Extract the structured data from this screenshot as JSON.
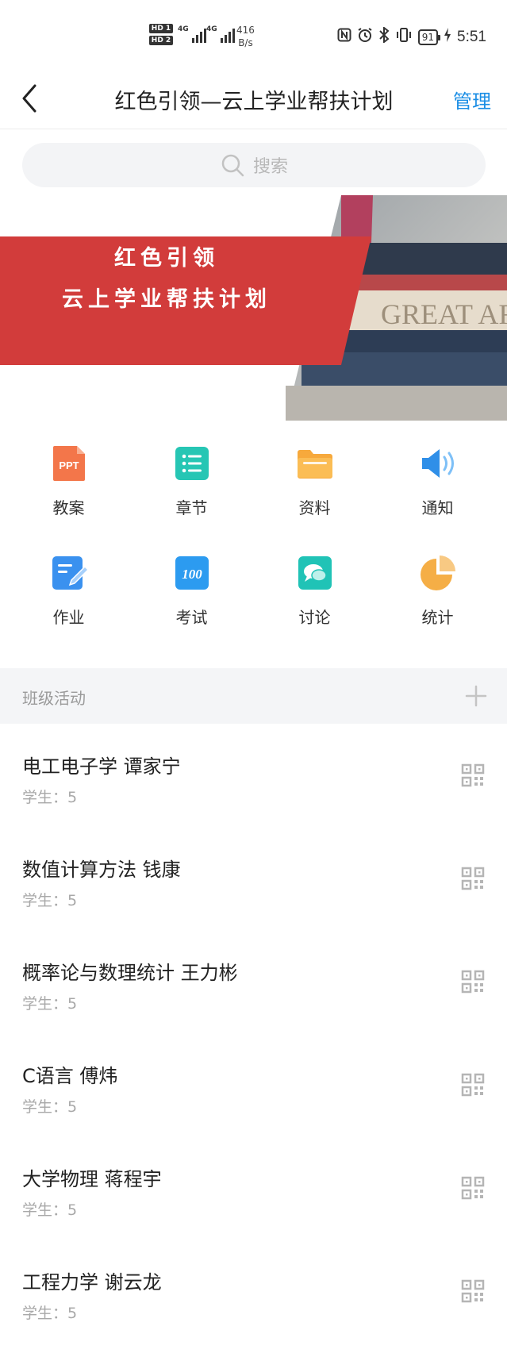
{
  "status_bar": {
    "hd1": "HD 1",
    "hd2": "HD 2",
    "network1": "4G",
    "network2": "4G",
    "speed_value": "416",
    "speed_unit": "B/s",
    "battery": "91",
    "time": "5:51",
    "icons": [
      "nfc-icon",
      "alarm-icon",
      "bluetooth-icon",
      "vibrate-icon",
      "battery-icon",
      "charging-icon"
    ]
  },
  "nav": {
    "title": "红色引领—云上学业帮扶计划",
    "manage_label": "管理"
  },
  "search": {
    "placeholder": "搜索"
  },
  "banner": {
    "line1": "红色引领",
    "line2": "云上学业帮扶计划",
    "book_text": "GREAT ARC"
  },
  "features": [
    {
      "label": "教案",
      "icon": "ppt-icon",
      "icon_text": "PPT",
      "color": "#f3764a"
    },
    {
      "label": "章节",
      "icon": "list-icon",
      "color": "#26c6b4"
    },
    {
      "label": "资料",
      "icon": "folder-icon",
      "color": "#f7a93c"
    },
    {
      "label": "通知",
      "icon": "speaker-icon",
      "color": "#2f8fe8"
    },
    {
      "label": "作业",
      "icon": "edit-icon",
      "color": "#3a91ef"
    },
    {
      "label": "考试",
      "icon": "exam-icon",
      "icon_text": "100",
      "color": "#2c9bf0"
    },
    {
      "label": "讨论",
      "icon": "chat-icon",
      "color": "#20c3b6"
    },
    {
      "label": "统计",
      "icon": "pie-chart-icon",
      "color": "#f5ae46"
    }
  ],
  "section": {
    "title": "班级活动"
  },
  "classes": [
    {
      "name": "电工电子学 谭家宁",
      "students": "学生：5"
    },
    {
      "name": "数值计算方法 钱康",
      "students": "学生：5"
    },
    {
      "name": "概率论与数理统计 王力彬",
      "students": "学生：5"
    },
    {
      "name": "C语言 傅炜",
      "students": "学生：5"
    },
    {
      "name": "大学物理 蒋程宇",
      "students": "学生：5"
    },
    {
      "name": "工程力学 谢云龙",
      "students": "学生：5"
    }
  ]
}
